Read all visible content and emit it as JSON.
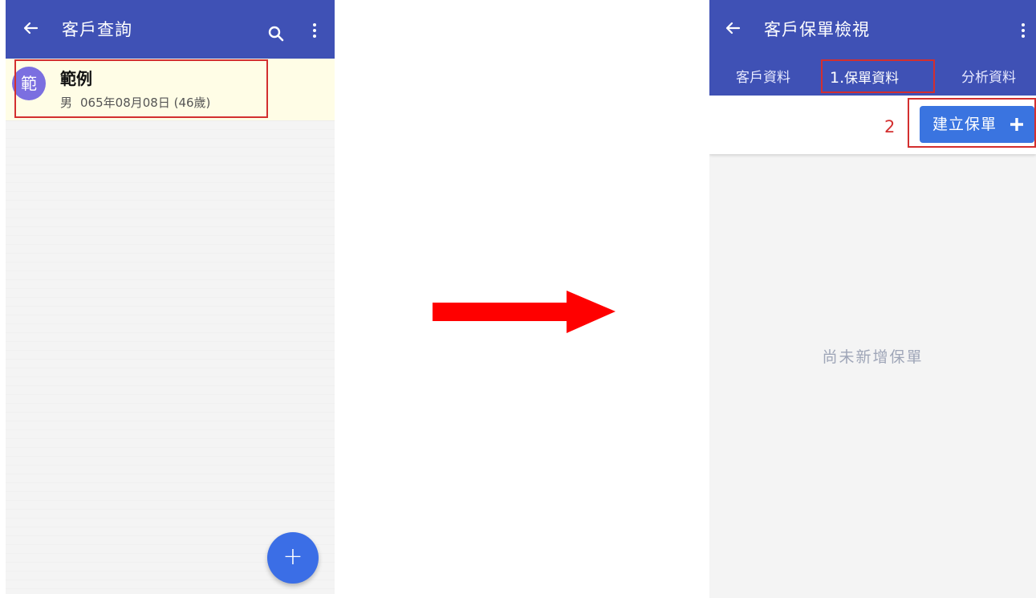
{
  "left_screen": {
    "title": "客戶查詢",
    "back_icon": "arrow-back-icon",
    "search_icon": "search-icon",
    "menu_icon": "more-vert-icon",
    "customer": {
      "avatar_char": "範",
      "name": "範例",
      "gender": "男",
      "birthday": "065年08月08日 (46歲)"
    },
    "fab_label": "+"
  },
  "right_screen": {
    "title": "客戶保單檢視",
    "back_icon": "arrow-back-icon",
    "menu_icon": "more-vert-icon",
    "tabs": [
      {
        "label": "客戶資料"
      },
      {
        "label": "保單資料",
        "step": "1."
      },
      {
        "label": "分析資料"
      }
    ],
    "step2_label": "2",
    "create_button_label": "建立保單",
    "create_button_icon": "plus-icon",
    "empty_message": "尚未新增保單"
  },
  "colors": {
    "app_bar": "#3f51b5",
    "highlight": "#d32f2f",
    "button": "#3a74e0",
    "fab": "#3b6ee6",
    "arrow": "#ff0000"
  }
}
